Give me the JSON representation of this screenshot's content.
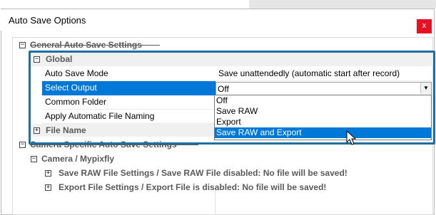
{
  "window": {
    "title": "Auto Save Options",
    "close_label": "x"
  },
  "tree": {
    "general_category": "General Auto Save Settings",
    "global_category": "Global",
    "properties": [
      {
        "name": "Auto Save Mode",
        "value": "Save unattendedly (automatic start after record)"
      },
      {
        "name": "Select Output",
        "value": "Off"
      },
      {
        "name": "Common Folder",
        "value": ""
      },
      {
        "name": "Apply Automatic File Naming",
        "value": ""
      }
    ],
    "file_name_category": "File Name",
    "camera_category": "Camera Specific Auto Save Settings",
    "camera_subcategory": "Camera / Mypixfly",
    "raw_settings": "Save RAW File Settings / Save RAW File disabled: No file will be saved!",
    "export_settings": "Export File Settings / Export File is disabled: No file will be saved!"
  },
  "dropdown": {
    "options": [
      "Off",
      "Save RAW",
      "Export",
      "Save RAW and Export"
    ],
    "highlighted_index": 3
  },
  "icons": {
    "expand": "plus-box-icon",
    "collapse": "minus-box-icon",
    "dropdown": "chevron-down-icon",
    "cursor": "mouse-pointer-icon"
  },
  "colors": {
    "selection": "#0078d7",
    "highlight_frame": "#1f6fa3",
    "close": "#e81123"
  }
}
